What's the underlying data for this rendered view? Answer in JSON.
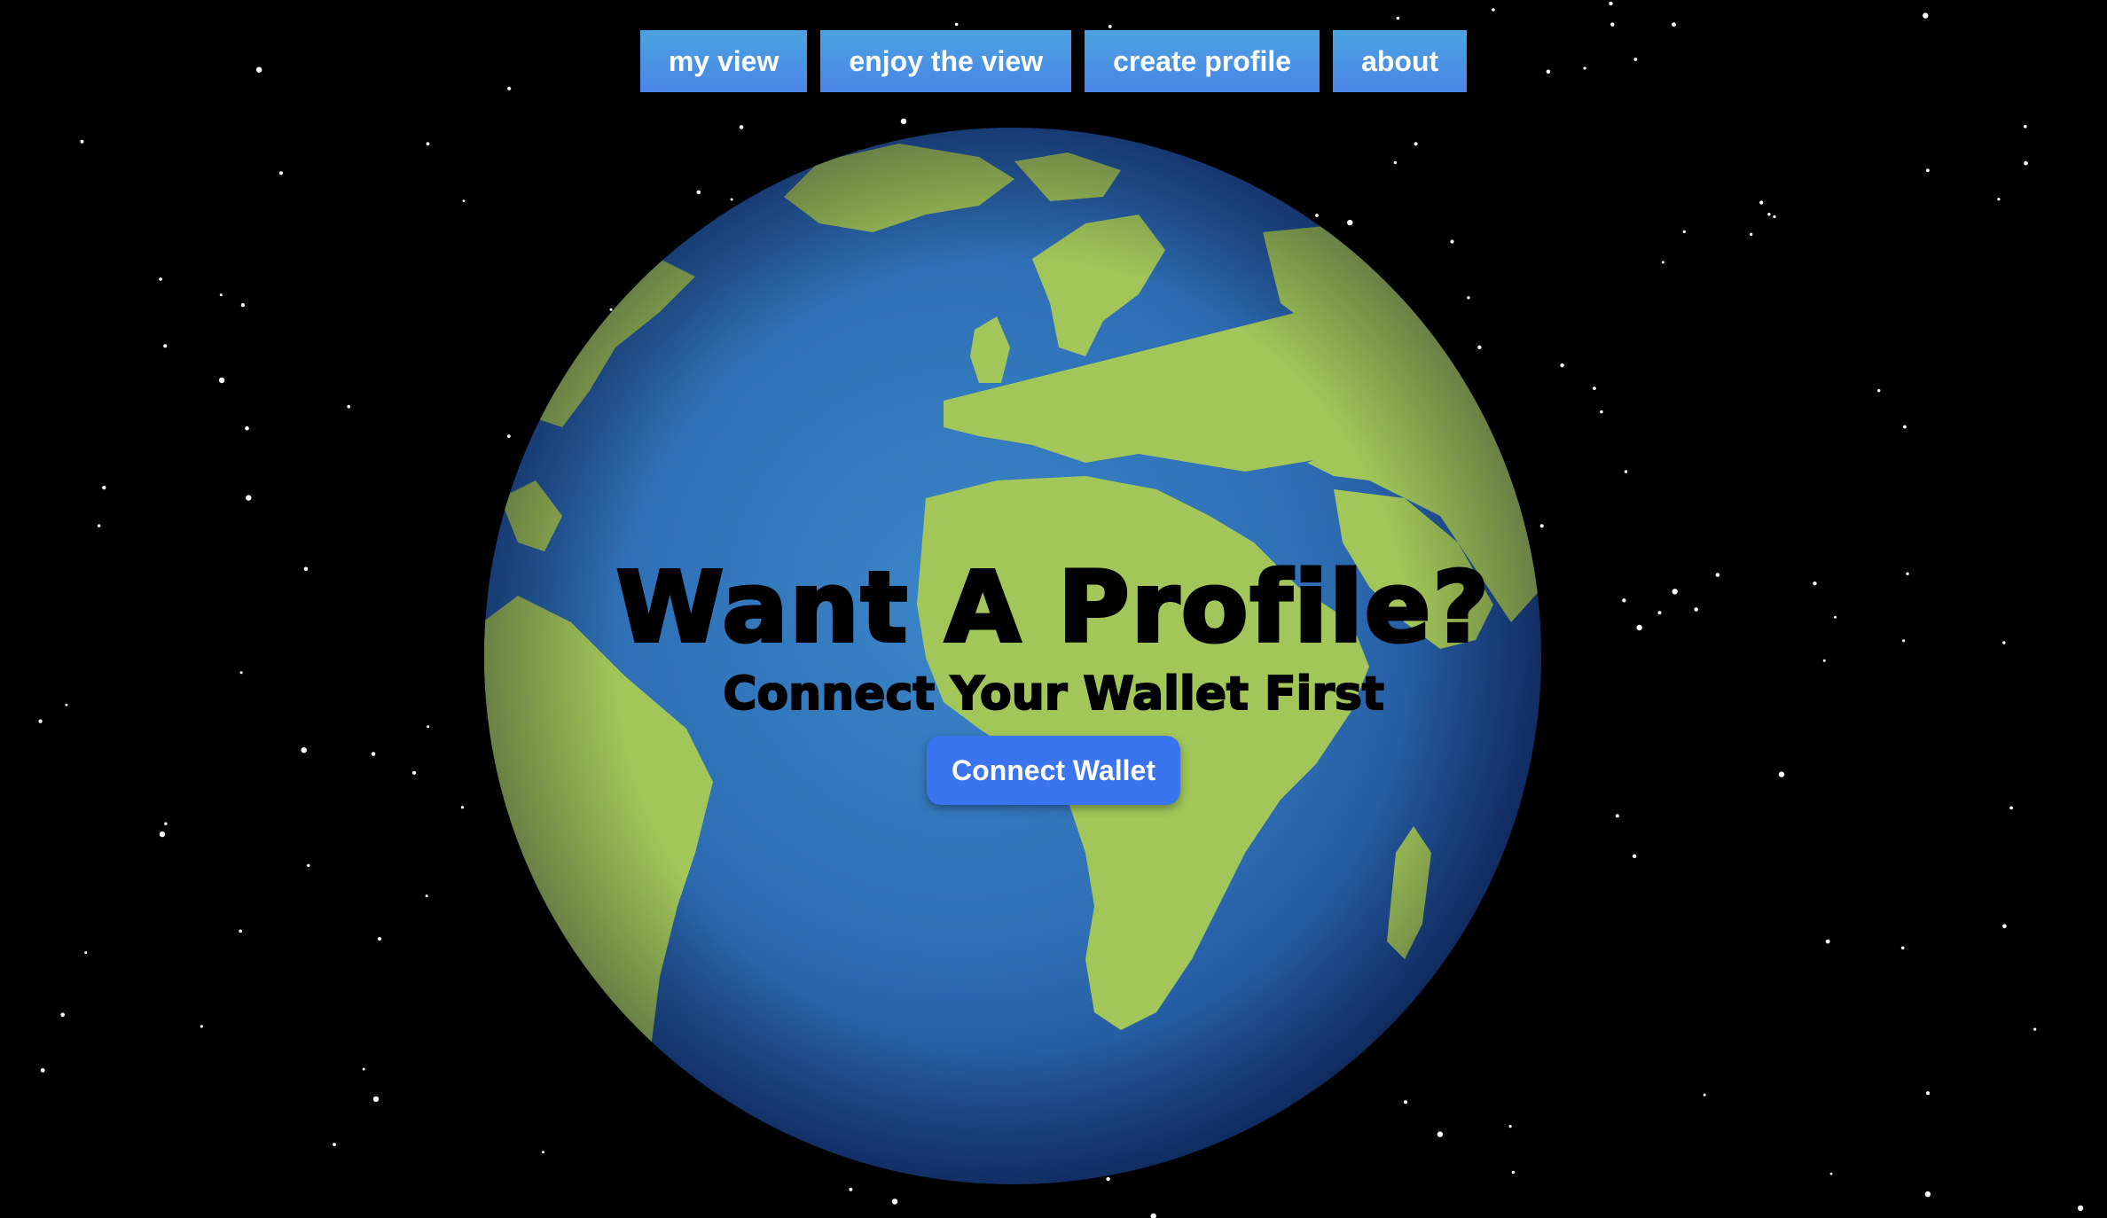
{
  "nav": {
    "items": [
      {
        "label": "my view"
      },
      {
        "label": "enjoy the view"
      },
      {
        "label": "create profile"
      },
      {
        "label": "about"
      }
    ]
  },
  "hero": {
    "title": "Want A Profile?",
    "subtitle": "Connect Your Wallet First",
    "button_label": "Connect Wallet"
  },
  "colors": {
    "background": "#000000",
    "nav_button": "#4a94e6",
    "ocean": "#2f6fb5",
    "land": "#a2c65a",
    "connect_button": "#3b74ef",
    "text": "#000000"
  },
  "icons": {
    "globe": "earth-globe-icon",
    "stars": "starfield"
  }
}
